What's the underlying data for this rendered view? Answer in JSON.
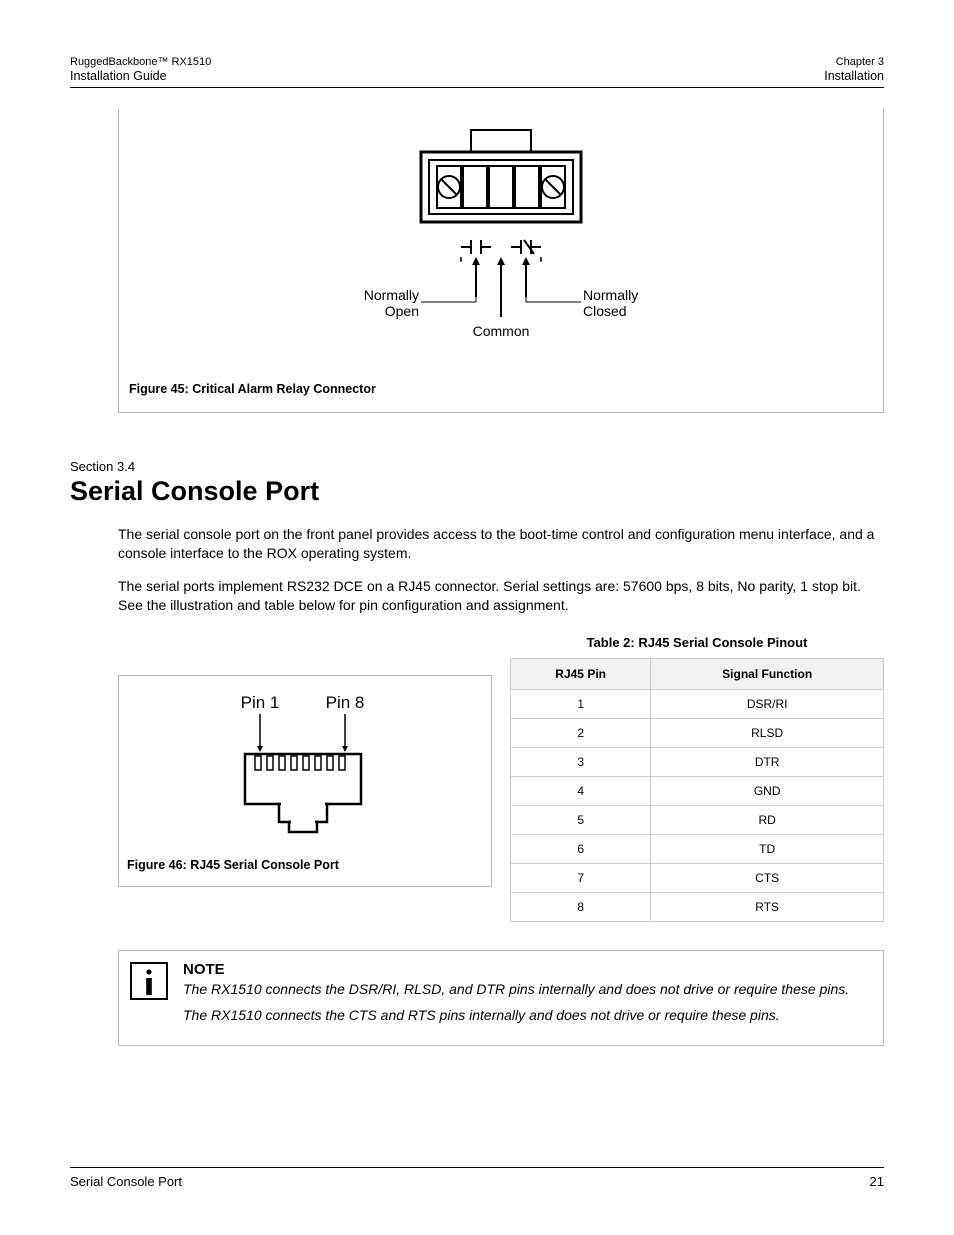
{
  "header": {
    "product": "RuggedBackbone™ RX1510",
    "doc": "Installation Guide",
    "chapter": "Chapter 3",
    "chapter_title": "Installation"
  },
  "figure45": {
    "caption": "Figure 45: Critical Alarm Relay Connector",
    "labels": {
      "no": "Normally Open",
      "common": "Common",
      "nc": "Normally Closed"
    }
  },
  "section": {
    "num": "Section 3.4",
    "title": "Serial Console Port",
    "p1": "The serial console port on the front panel provides access to the boot-time control and configuration menu interface, and a console interface to the ROX operating system.",
    "p2": "The serial ports implement RS232 DCE on a RJ45 connector. Serial settings are: 57600 bps, 8 bits, No parity, 1 stop bit. See the illustration and table below for pin configuration and assignment."
  },
  "figure46": {
    "caption": "Figure 46: RJ45 Serial Console Port",
    "pin1": "Pin 1",
    "pin8": "Pin 8"
  },
  "table2": {
    "caption": "Table 2: RJ45 Serial Console Pinout",
    "headers": [
      "RJ45 Pin",
      "Signal Function"
    ],
    "rows": [
      [
        "1",
        "DSR/RI"
      ],
      [
        "2",
        "RLSD"
      ],
      [
        "3",
        "DTR"
      ],
      [
        "4",
        "GND"
      ],
      [
        "5",
        "RD"
      ],
      [
        "6",
        "TD"
      ],
      [
        "7",
        "CTS"
      ],
      [
        "8",
        "RTS"
      ]
    ]
  },
  "note": {
    "title": "NOTE",
    "p1": "The RX1510 connects the DSR/RI, RLSD, and DTR pins internally and does not drive or require these pins.",
    "p2": "The RX1510 connects the CTS and RTS pins internally and does not drive or require these pins."
  },
  "footer": {
    "left": "Serial Console Port",
    "right": "21"
  }
}
